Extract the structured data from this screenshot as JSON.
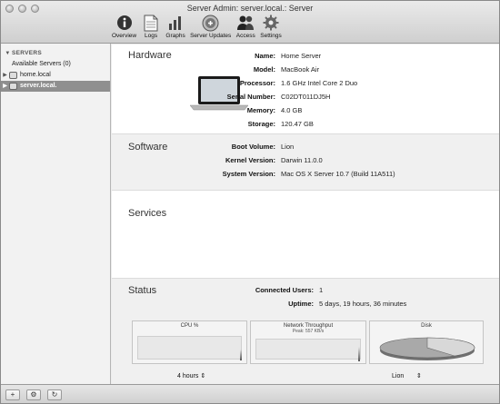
{
  "window": {
    "title": "Server Admin: server.local.: Server"
  },
  "toolbar": {
    "items": [
      {
        "label": "Overview",
        "icon": "info-icon"
      },
      {
        "label": "Logs",
        "icon": "document-icon"
      },
      {
        "label": "Graphs",
        "icon": "bar-graph-icon"
      },
      {
        "label": "Server Updates",
        "icon": "updates-icon"
      },
      {
        "label": "Access",
        "icon": "users-icon"
      },
      {
        "label": "Settings",
        "icon": "gear-icon"
      }
    ]
  },
  "sidebar": {
    "header": "SERVERS",
    "available": "Available Servers (0)",
    "items": [
      {
        "label": "home.local"
      },
      {
        "label": "server.local."
      }
    ]
  },
  "hardware": {
    "title": "Hardware",
    "fields": [
      {
        "key": "Name:",
        "value": "Home Server"
      },
      {
        "key": "Model:",
        "value": "MacBook Air"
      },
      {
        "key": "Processor:",
        "value": "1.6 GHz Intel Core 2 Duo"
      },
      {
        "key": "Serial Number:",
        "value": "C02DT011DJ5H"
      },
      {
        "key": "Memory:",
        "value": "4.0 GB"
      },
      {
        "key": "Storage:",
        "value": "120.47 GB"
      }
    ]
  },
  "software": {
    "title": "Software",
    "fields": [
      {
        "key": "Boot Volume:",
        "value": "Lion"
      },
      {
        "key": "Kernel Version:",
        "value": "Darwin 11.0.0"
      },
      {
        "key": "System Version:",
        "value": "Mac OS X Server 10.7 (Build 11A511)"
      }
    ]
  },
  "services": {
    "title": "Services"
  },
  "status": {
    "title": "Status",
    "fields": [
      {
        "key": "Connected Users:",
        "value": "1"
      },
      {
        "key": "Uptime:",
        "value": "5 days, 19 hours, 36 minutes"
      }
    ],
    "panels": {
      "cpu": {
        "title": "CPU %"
      },
      "network": {
        "title": "Network Throughput",
        "subtitle": "Peak: 557 KB/s"
      },
      "disk": {
        "title": "Disk"
      }
    },
    "range_select": "4 hours",
    "volume_select": "Lion"
  },
  "bottombar": {
    "add": "+",
    "action": "⚙",
    "refresh": "↻"
  }
}
